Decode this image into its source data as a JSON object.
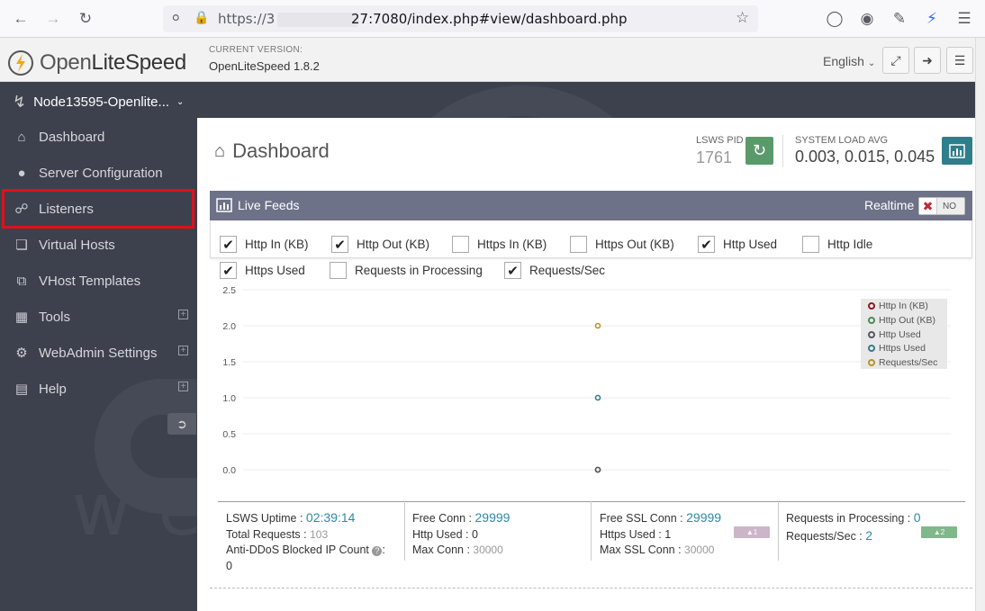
{
  "browser": {
    "url_prefix": "https://3",
    "url_suffix": "27:7080/index.php#view/dashboard.php"
  },
  "header": {
    "logo_open": "Open",
    "logo_lite": "LiteSpeed",
    "version_label": "CURRENT VERSION:",
    "version_value": "OpenLiteSpeed 1.8.2",
    "language": "English"
  },
  "sidebar": {
    "node_name": "Node13595-Openlite...",
    "items": [
      {
        "label": "Dashboard",
        "icon": "home-icon"
      },
      {
        "label": "Server Configuration",
        "icon": "globe-icon"
      },
      {
        "label": "Listeners",
        "icon": "link-icon"
      },
      {
        "label": "Virtual Hosts",
        "icon": "cubes-icon"
      },
      {
        "label": "VHost Templates",
        "icon": "copy-icon"
      },
      {
        "label": "Tools",
        "icon": "grid-icon"
      },
      {
        "label": "WebAdmin Settings",
        "icon": "gear-icon"
      },
      {
        "label": "Help",
        "icon": "book-icon"
      }
    ]
  },
  "dashboard": {
    "title": "Dashboard",
    "pid_label": "LSWS PID",
    "pid_value": "1761",
    "load_label": "SYSTEM LOAD AVG",
    "load_value": "0.003, 0.015, 0.045"
  },
  "live_feeds": {
    "title": "Live Feeds",
    "realtime_label": "Realtime",
    "realtime_state": "NO",
    "checkboxes": [
      {
        "label": "Http In (KB)",
        "checked": true
      },
      {
        "label": "Http Out (KB)",
        "checked": true
      },
      {
        "label": "Https In (KB)",
        "checked": false
      },
      {
        "label": "Https Out (KB)",
        "checked": false
      },
      {
        "label": "Http Used",
        "checked": true
      },
      {
        "label": "Http Idle",
        "checked": false
      },
      {
        "label": "Https Used",
        "checked": true
      },
      {
        "label": "Requests in Processing",
        "checked": false
      },
      {
        "label": "Requests/Sec",
        "checked": true
      }
    ]
  },
  "chart_data": {
    "type": "scatter",
    "ylim": [
      0,
      2.5
    ],
    "yticks": [
      "2.5",
      "2.0",
      "1.5",
      "1.0",
      "0.5",
      "0.0"
    ],
    "series": [
      {
        "name": "Http In (KB)",
        "color": "#8b1a1a",
        "values": [
          0
        ]
      },
      {
        "name": "Http Out (KB)",
        "color": "#4a8a5a",
        "values": [
          0
        ]
      },
      {
        "name": "Http Used",
        "color": "#555566",
        "values": [
          0
        ]
      },
      {
        "name": "Https Used",
        "color": "#3a7a8a",
        "values": [
          1
        ]
      },
      {
        "name": "Requests/Sec",
        "color": "#b8942a",
        "values": [
          2
        ]
      }
    ]
  },
  "stats": {
    "uptime_label": "LSWS Uptime :",
    "uptime_value": "02:39:14",
    "total_req_label": "Total Requests :",
    "total_req_value": "103",
    "ddos_label": "Anti-DDoS Blocked IP Count",
    "ddos_value": "0",
    "free_conn_label": "Free Conn :",
    "free_conn_value": "29999",
    "http_used_label": "Http Used :",
    "http_used_value": "0",
    "max_conn_label": "Max Conn :",
    "max_conn_value": "30000",
    "free_ssl_label": "Free SSL Conn :",
    "free_ssl_value": "29999",
    "https_used_label": "Https Used :",
    "https_used_value": "1",
    "max_ssl_label": "Max SSL Conn :",
    "max_ssl_value": "30000",
    "ssl_badge": "▲1",
    "req_proc_label": "Requests in Processing :",
    "req_proc_value": "0",
    "req_sec_label": "Requests/Sec :",
    "req_sec_value": "2",
    "req_badge": "▲2"
  }
}
